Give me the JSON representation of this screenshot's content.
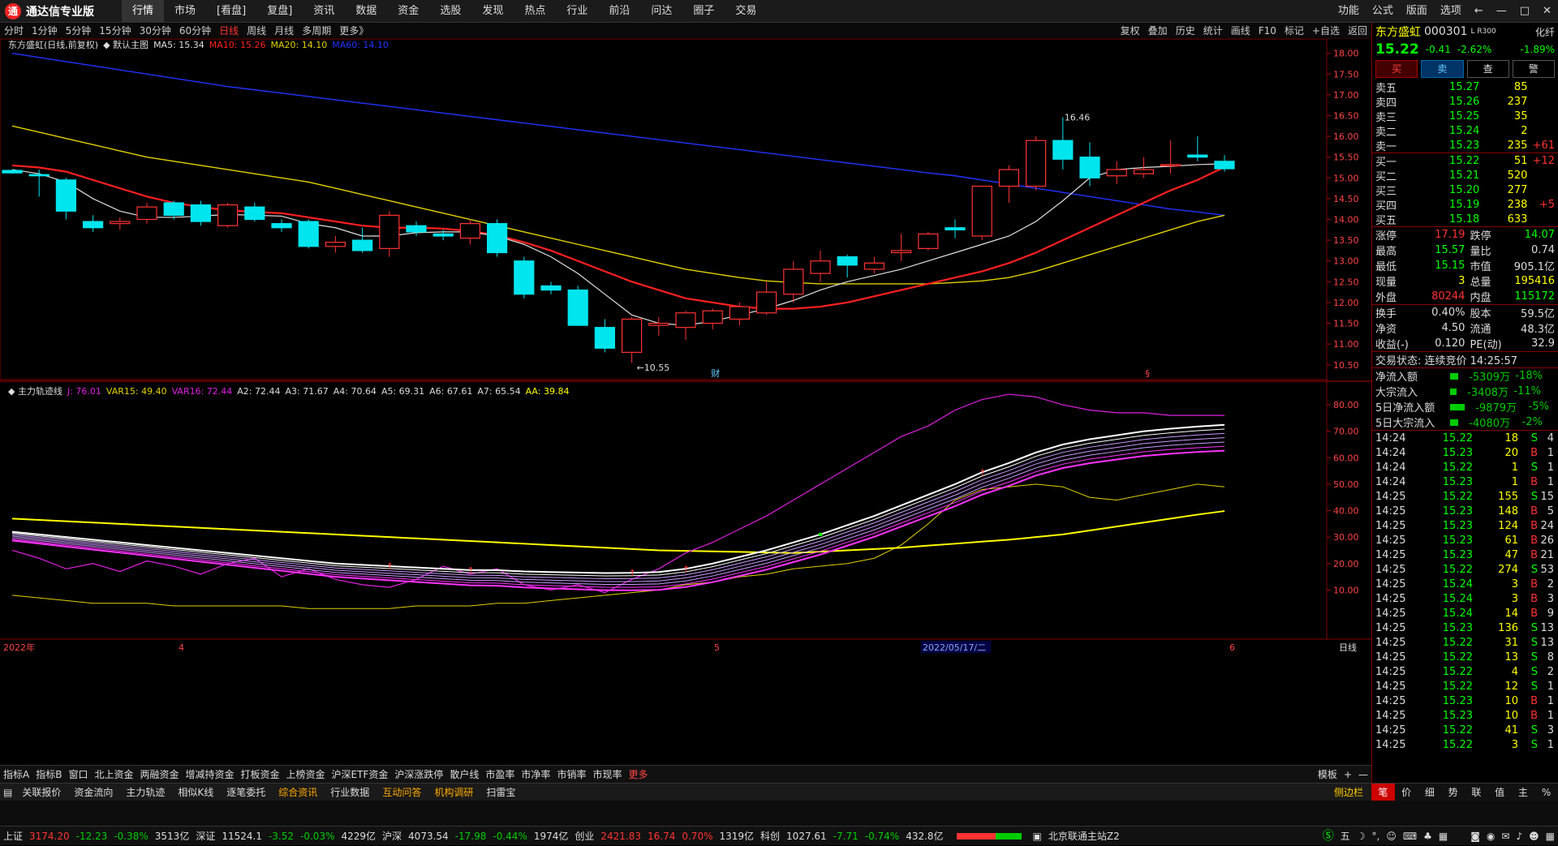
{
  "app": {
    "title": "通达信专业版",
    "logo_char": "通"
  },
  "menu": [
    "行情",
    "市场",
    "[看盘]",
    "复盘]",
    "资讯",
    "数据",
    "资金",
    "选股",
    "发现",
    "热点",
    "行业",
    "前沿",
    "问达",
    "圈子",
    "交易"
  ],
  "menu_active": 0,
  "menu_right": [
    "功能",
    "公式",
    "版面",
    "选项",
    "←",
    "—",
    "□",
    "✕"
  ],
  "periods": [
    "分时",
    "1分钟",
    "5分钟",
    "15分钟",
    "30分钟",
    "60分钟",
    "日线",
    "周线",
    "月线",
    "多周期",
    "更多》"
  ],
  "period_active": 6,
  "tools": [
    "复权",
    "叠加",
    "历史",
    "统计",
    "画线",
    "F10",
    "标记",
    "+自选",
    "返回"
  ],
  "main_header": {
    "name": "东方盛虹(日线,前复权)",
    "theme": "◆ 默认主图",
    "ma5": "MA5: 15.34",
    "ma10": "MA10: 15.26",
    "ma20": "MA20: 14.10",
    "ma60": "MA60: 14.10"
  },
  "sub_header": {
    "name": "◆ 主力轨迹线",
    "j": "J: 76.01",
    "var15": "VAR15: 49.40",
    "var16": "VAR16: 72.44",
    "a2": "A2: 72.44",
    "a3": "A3: 71.67",
    "a4": "A4: 70.64",
    "a5": "A5: 69.31",
    "a6": "A6: 67.61",
    "a7": "A7: 65.54",
    "aa": "AA: 39.84"
  },
  "annotations": {
    "high": "16.46",
    "low": "←10.55",
    "fin": "财",
    "s": "§"
  },
  "date_axis": {
    "left": "2022年",
    "m1": "4",
    "m2": "5",
    "cursor": "2022/05/17/二",
    "m3": "6",
    "right": "日线"
  },
  "price_axis": [
    "18.00",
    "17.50",
    "17.00",
    "16.50",
    "16.00",
    "15.50",
    "15.00",
    "14.50",
    "14.00",
    "13.50",
    "13.00",
    "12.50",
    "12.00",
    "11.50",
    "11.00",
    "10.50"
  ],
  "sub_axis": [
    "80.00",
    "70.00",
    "60.00",
    "50.00",
    "40.00",
    "30.00",
    "20.00",
    "10.00"
  ],
  "chart_data": {
    "type": "candlestick",
    "ohlc": [
      [
        15.18,
        15.2,
        15.1,
        15.12
      ],
      [
        15.08,
        15.2,
        14.55,
        15.05
      ],
      [
        14.95,
        15.0,
        14.0,
        14.2
      ],
      [
        13.95,
        14.1,
        13.7,
        13.8
      ],
      [
        13.9,
        14.05,
        13.75,
        13.95
      ],
      [
        14.0,
        14.4,
        13.9,
        14.3
      ],
      [
        14.4,
        14.45,
        14.0,
        14.1
      ],
      [
        14.35,
        14.45,
        13.85,
        13.95
      ],
      [
        13.85,
        14.4,
        13.8,
        14.35
      ],
      [
        14.3,
        14.4,
        13.95,
        14.0
      ],
      [
        13.9,
        14.0,
        13.7,
        13.8
      ],
      [
        13.95,
        14.0,
        13.3,
        13.35
      ],
      [
        13.35,
        13.6,
        13.2,
        13.45
      ],
      [
        13.5,
        13.8,
        13.2,
        13.25
      ],
      [
        13.3,
        14.2,
        13.1,
        14.1
      ],
      [
        13.85,
        13.95,
        13.6,
        13.7
      ],
      [
        13.65,
        13.75,
        13.5,
        13.6
      ],
      [
        13.55,
        14.0,
        13.4,
        13.9
      ],
      [
        13.9,
        14.0,
        13.1,
        13.2
      ],
      [
        13.0,
        13.1,
        12.1,
        12.2
      ],
      [
        12.4,
        12.5,
        12.2,
        12.3
      ],
      [
        12.3,
        12.4,
        11.5,
        11.45
      ],
      [
        11.4,
        11.6,
        10.8,
        10.9
      ],
      [
        10.8,
        11.65,
        10.55,
        11.6
      ],
      [
        11.45,
        11.65,
        11.2,
        11.5
      ],
      [
        11.4,
        11.8,
        11.1,
        11.75
      ],
      [
        11.5,
        11.85,
        11.35,
        11.8
      ],
      [
        11.6,
        12.0,
        11.45,
        11.9
      ],
      [
        11.75,
        12.5,
        11.7,
        12.25
      ],
      [
        12.2,
        13.0,
        12.0,
        12.8
      ],
      [
        12.7,
        13.25,
        12.5,
        13.0
      ],
      [
        13.1,
        13.15,
        12.6,
        12.9
      ],
      [
        12.8,
        13.1,
        12.7,
        12.95
      ],
      [
        13.2,
        13.65,
        13.0,
        13.25
      ],
      [
        13.3,
        13.7,
        13.25,
        13.65
      ],
      [
        13.8,
        14.0,
        13.55,
        13.75
      ],
      [
        13.6,
        14.8,
        13.5,
        14.8
      ],
      [
        14.8,
        15.3,
        14.4,
        15.2
      ],
      [
        14.8,
        16.0,
        14.7,
        15.9
      ],
      [
        15.9,
        16.46,
        15.2,
        15.45
      ],
      [
        15.5,
        15.85,
        14.8,
        15.0
      ],
      [
        15.05,
        15.4,
        14.85,
        15.2
      ],
      [
        15.1,
        15.5,
        15.0,
        15.2
      ],
      [
        15.3,
        15.9,
        15.1,
        15.32
      ],
      [
        15.55,
        16.0,
        15.4,
        15.5
      ],
      [
        15.4,
        15.55,
        15.15,
        15.22
      ]
    ],
    "ma5": [
      15.2,
      15.1,
      14.9,
      14.5,
      14.2,
      14.05,
      14.05,
      14.08,
      14.12,
      14.1,
      14.08,
      13.9,
      13.8,
      13.6,
      13.6,
      13.68,
      13.7,
      13.7,
      13.6,
      13.4,
      13.1,
      12.7,
      12.2,
      11.7,
      11.5,
      11.45,
      11.55,
      11.7,
      11.85,
      12.05,
      12.3,
      12.5,
      12.65,
      12.8,
      13.0,
      13.2,
      13.4,
      13.6,
      13.95,
      14.45,
      15.0,
      15.2,
      15.25,
      15.28,
      15.32,
      15.34
    ],
    "ma10": [
      15.3,
      15.25,
      15.15,
      14.95,
      14.75,
      14.55,
      14.4,
      14.3,
      14.22,
      14.18,
      14.15,
      14.05,
      13.95,
      13.85,
      13.8,
      13.8,
      13.78,
      13.72,
      13.62,
      13.45,
      13.25,
      13.0,
      12.75,
      12.5,
      12.3,
      12.1,
      12.0,
      11.9,
      11.85,
      11.85,
      11.9,
      12.0,
      12.15,
      12.3,
      12.45,
      12.6,
      12.75,
      12.95,
      13.2,
      13.5,
      13.8,
      14.1,
      14.4,
      14.7,
      14.95,
      15.26
    ],
    "ma20": [
      16.25,
      16.1,
      15.95,
      15.8,
      15.65,
      15.5,
      15.4,
      15.3,
      15.2,
      15.1,
      15.0,
      14.9,
      14.75,
      14.6,
      14.45,
      14.3,
      14.15,
      14.0,
      13.85,
      13.7,
      13.55,
      13.4,
      13.25,
      13.1,
      12.95,
      12.8,
      12.7,
      12.6,
      12.52,
      12.48,
      12.45,
      12.45,
      12.45,
      12.45,
      12.45,
      12.48,
      12.52,
      12.6,
      12.75,
      12.95,
      13.15,
      13.35,
      13.55,
      13.75,
      13.95,
      14.1
    ],
    "ma60": [
      18.0,
      17.9,
      17.8,
      17.7,
      17.6,
      17.5,
      17.4,
      17.3,
      17.2,
      17.12,
      17.04,
      16.96,
      16.88,
      16.8,
      16.72,
      16.64,
      16.56,
      16.48,
      16.4,
      16.32,
      16.24,
      16.16,
      16.08,
      16.0,
      15.92,
      15.84,
      15.76,
      15.68,
      15.6,
      15.52,
      15.44,
      15.36,
      15.28,
      15.2,
      15.12,
      15.05,
      14.95,
      14.85,
      14.75,
      14.65,
      14.55,
      14.45,
      14.35,
      14.25,
      14.18,
      14.1
    ],
    "sub": {
      "j": [
        25,
        22,
        18,
        20,
        17,
        21,
        19,
        16,
        20,
        22,
        15,
        18,
        14,
        12,
        11,
        14,
        19,
        16,
        18,
        12,
        10,
        12,
        9,
        14,
        18,
        24,
        28,
        33,
        38,
        44,
        50,
        56,
        62,
        68,
        72,
        78,
        82,
        84,
        83,
        80,
        78,
        77,
        77,
        76,
        76,
        76
      ],
      "var15": [
        8,
        7,
        6,
        5,
        5,
        5,
        4,
        4,
        4,
        4,
        4,
        3,
        3,
        3,
        3,
        4,
        4,
        4,
        5,
        5,
        6,
        7,
        8,
        9,
        10,
        12,
        13,
        15,
        16,
        18,
        19,
        20,
        22,
        27,
        35,
        44,
        48,
        49,
        50,
        49,
        45,
        44,
        46,
        48,
        50,
        49
      ],
      "aa": [
        37,
        36.5,
        36,
        35.5,
        35,
        34.5,
        34,
        33.5,
        33,
        32.5,
        32,
        31.5,
        31,
        30.5,
        30,
        29.5,
        29,
        28.5,
        28,
        27.5,
        27,
        26.5,
        26,
        25.5,
        25,
        24.8,
        24.6,
        24.4,
        24.2,
        24,
        24.5,
        25,
        25.5,
        26,
        26.8,
        27.5,
        28.3,
        29,
        30,
        31,
        32.5,
        34,
        35.5,
        37,
        38.5,
        39.84
      ],
      "a2": [
        32,
        31,
        30,
        29,
        28,
        27,
        26,
        25,
        24,
        23,
        22,
        21,
        20,
        19.5,
        19,
        18.5,
        18,
        17.5,
        17.5,
        17,
        16.8,
        16.6,
        16.4,
        16.5,
        16.8,
        18,
        20,
        22.5,
        25,
        28,
        31,
        34.5,
        38,
        42,
        46,
        50,
        54.5,
        58,
        62,
        65,
        67,
        68.5,
        70,
        71,
        71.8,
        72.44
      ]
    }
  },
  "quote": {
    "name": "东方盛虹",
    "code": "000301",
    "tag": "L R300",
    "opt": "化纤",
    "price": "15.22",
    "chg": "-0.41",
    "pct": "-2.62%",
    "opt_pct": "-1.89%",
    "btns": [
      "买",
      "卖",
      "查",
      "警"
    ],
    "asks": [
      [
        "卖五",
        "15.27",
        "85",
        ""
      ],
      [
        "卖四",
        "15.26",
        "237",
        ""
      ],
      [
        "卖三",
        "15.25",
        "35",
        ""
      ],
      [
        "卖二",
        "15.24",
        "2",
        ""
      ],
      [
        "卖一",
        "15.23",
        "235",
        "+61"
      ]
    ],
    "bids": [
      [
        "买一",
        "15.22",
        "51",
        "+12"
      ],
      [
        "买二",
        "15.21",
        "520",
        ""
      ],
      [
        "买三",
        "15.20",
        "277",
        ""
      ],
      [
        "买四",
        "15.19",
        "238",
        "+5"
      ],
      [
        "买五",
        "15.18",
        "633",
        ""
      ]
    ],
    "stats": [
      [
        "涨停",
        "17.19",
        "跌停",
        "14.07"
      ],
      [
        "最高",
        "15.57",
        "量比",
        "0.74"
      ],
      [
        "最低",
        "15.15",
        "市值",
        "905.1亿"
      ],
      [
        "现量",
        "3",
        "总量",
        "195416"
      ],
      [
        "外盘",
        "80244",
        "内盘",
        "115172"
      ]
    ],
    "stats2": [
      [
        "换手",
        "0.40%",
        "股本",
        "59.5亿"
      ],
      [
        "净资",
        "4.50",
        "流通",
        "48.3亿"
      ],
      [
        "收益(-)",
        "0.120",
        "PE(动)",
        "32.9"
      ]
    ],
    "state": "交易状态: 连续竞价 14:25:57",
    "flows": [
      [
        "净流入额",
        "-5309万",
        "-18%"
      ],
      [
        "大宗流入",
        "-3408万",
        "-11%"
      ],
      [
        "5日净流入额",
        "-9879万",
        "-5%"
      ],
      [
        "5日大宗流入",
        "-4080万",
        "-2%"
      ]
    ],
    "ticks": [
      [
        "14:24",
        "15.22",
        "18",
        "S",
        "4"
      ],
      [
        "14:24",
        "15.23",
        "20",
        "B",
        "1"
      ],
      [
        "14:24",
        "15.22",
        "1",
        "S",
        "1"
      ],
      [
        "14:24",
        "15.23",
        "1",
        "B",
        "1"
      ],
      [
        "14:25",
        "15.22",
        "155",
        "S",
        "15"
      ],
      [
        "14:25",
        "15.23",
        "148",
        "B",
        "5"
      ],
      [
        "14:25",
        "15.23",
        "124",
        "B",
        "24"
      ],
      [
        "14:25",
        "15.23",
        "61",
        "B",
        "26"
      ],
      [
        "14:25",
        "15.23",
        "47",
        "B",
        "21"
      ],
      [
        "14:25",
        "15.22",
        "274",
        "S",
        "53"
      ],
      [
        "14:25",
        "15.24",
        "3",
        "B",
        "2"
      ],
      [
        "14:25",
        "15.24",
        "3",
        "B",
        "3"
      ],
      [
        "14:25",
        "15.24",
        "14",
        "B",
        "9"
      ],
      [
        "14:25",
        "15.23",
        "136",
        "S",
        "13"
      ],
      [
        "14:25",
        "15.22",
        "31",
        "S",
        "13"
      ],
      [
        "14:25",
        "15.22",
        "13",
        "S",
        "8"
      ],
      [
        "14:25",
        "15.22",
        "4",
        "S",
        "2"
      ],
      [
        "14:25",
        "15.22",
        "12",
        "S",
        "1"
      ],
      [
        "14:25",
        "15.23",
        "10",
        "B",
        "1"
      ],
      [
        "14:25",
        "15.23",
        "10",
        "B",
        "1"
      ],
      [
        "14:25",
        "15.22",
        "41",
        "S",
        "3"
      ],
      [
        "14:25",
        "15.22",
        "3",
        "S",
        "1"
      ]
    ]
  },
  "bottom_tabs": [
    "指标A",
    "指标B",
    "窗口",
    "北上资金",
    "两融资金",
    "增减持资金",
    "打板资金",
    "上榜资金",
    "沪深ETF资金",
    "沪深涨跌停",
    "散户线",
    "市盈率",
    "市净率",
    "市销率",
    "市现率",
    "更多"
  ],
  "bottom_right": [
    "模板",
    "+",
    "—"
  ],
  "func_tabs": [
    "关联报价",
    "资金流向",
    "主力轨迹",
    "相似K线",
    "逐笔委托",
    "综合资讯",
    "行业数据",
    "互动问答",
    "机构调研",
    "扫雷宝"
  ],
  "func_hl": [
    5,
    7,
    8
  ],
  "func_corner": "侧边栏",
  "quote_tabs": [
    "笔",
    "价",
    "细",
    "势",
    "联",
    "值",
    "主",
    "%"
  ],
  "status": [
    [
      "上证",
      "w"
    ],
    [
      "3174.20",
      "up"
    ],
    [
      "-12.23",
      "dn"
    ],
    [
      "-0.38%",
      "dn"
    ],
    [
      "3513亿",
      "w"
    ],
    [
      "深证",
      "w"
    ],
    [
      "11524.1",
      "w"
    ],
    [
      "-3.52",
      "dn"
    ],
    [
      "-0.03%",
      "dn"
    ],
    [
      "4229亿",
      "w"
    ],
    [
      "沪深",
      "w"
    ],
    [
      "4073.54",
      "w"
    ],
    [
      "-17.98",
      "dn"
    ],
    [
      "-0.44%",
      "dn"
    ],
    [
      "1974亿",
      "w"
    ],
    [
      "创业",
      "w"
    ],
    [
      "2421.83",
      "up"
    ],
    [
      "16.74",
      "up"
    ],
    [
      "0.70%",
      "up"
    ],
    [
      "1319亿",
      "w"
    ],
    [
      "科创",
      "w"
    ],
    [
      "1027.61",
      "w"
    ],
    [
      "-7.71",
      "dn"
    ],
    [
      "-0.74%",
      "dn"
    ],
    [
      "432.8亿",
      "w"
    ]
  ],
  "status_right": "北京联通主站Z2",
  "colors": {
    "up": "#ff3333",
    "down": "#00e5ee",
    "ma5": "#e0e0e0",
    "ma10": "#ff2020",
    "ma20": "#e0d000",
    "ma60": "#2233ff",
    "j": "#e020e0",
    "var15": "#e0d000",
    "aa": "#ffff00",
    "band": "#ffffff",
    "pink": "#ff33ff"
  }
}
